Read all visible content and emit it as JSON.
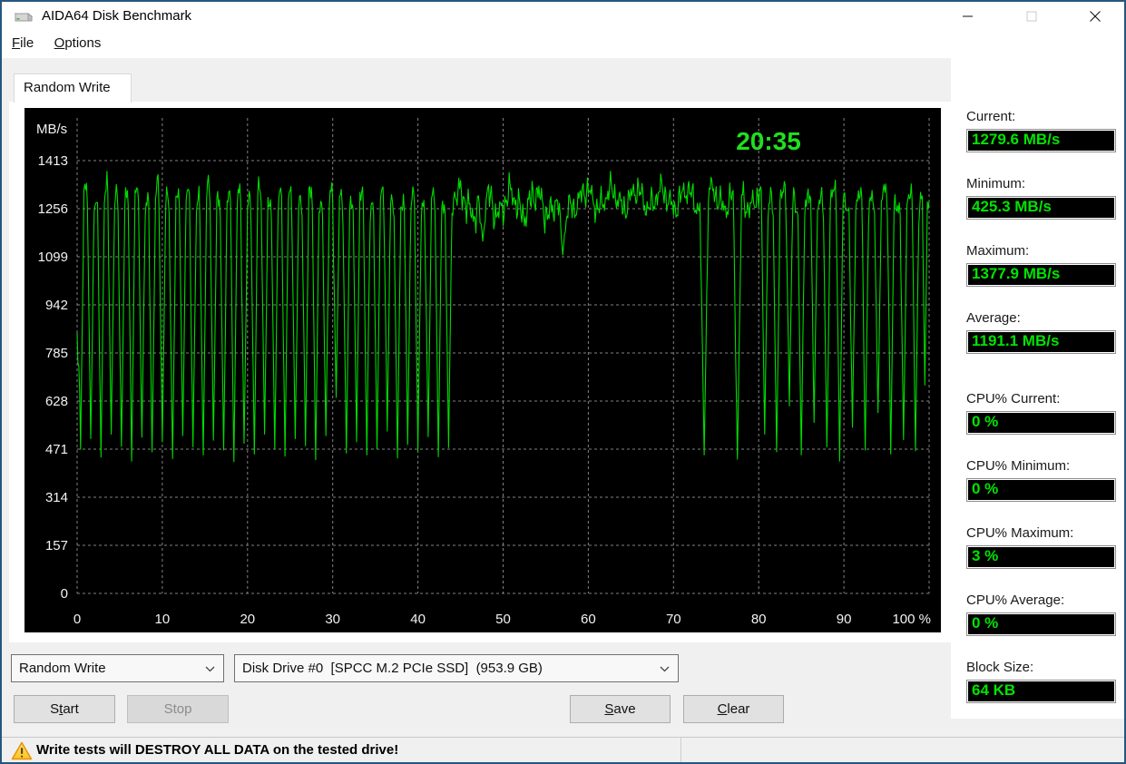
{
  "window": {
    "title": "AIDA64 Disk Benchmark",
    "app_icon": "disk-drive-icon",
    "controls": {
      "minimize": "minimize",
      "maximize": "maximize",
      "close": "close"
    }
  },
  "menu": {
    "file": {
      "text": "File",
      "accel": 0
    },
    "options": {
      "text": "Options",
      "accel": 0
    }
  },
  "tab": {
    "label": "Random Write"
  },
  "chart_data": {
    "type": "line",
    "series_name": "Random Write transfer rate",
    "unit": "MB/s",
    "ylabel": "MB/s",
    "elapsed_time": "20:35",
    "xlim": [
      0,
      100
    ],
    "ylim": [
      0,
      1570
    ],
    "y_ticks": [
      0,
      157,
      314,
      471,
      628,
      785,
      942,
      1099,
      1256,
      1413
    ],
    "x_ticks": [
      0,
      10,
      20,
      30,
      40,
      50,
      60,
      70,
      80,
      90,
      100
    ],
    "x_last_tick_label": "100 %",
    "grid": "dashed",
    "bg_color": "#000000",
    "line_color": "#00dc00",
    "timer_color": "#1fe01f",
    "axis_text_color": "#f2f2f2",
    "current": 1279.6,
    "minimum": 425.3,
    "maximum": 1377.9,
    "average": 1191.1,
    "baseline_segments": [
      {
        "x0": 0,
        "x1": 44.5,
        "mean": 1298,
        "amp": 58
      },
      {
        "x0": 44.5,
        "x1": 58.0,
        "mean": 1272,
        "amp": 80
      },
      {
        "x0": 58.0,
        "x1": 80.3,
        "mean": 1288,
        "amp": 66
      },
      {
        "x0": 80.3,
        "x1": 100.0,
        "mean": 1292,
        "amp": 60
      }
    ],
    "dips": [
      [
        0.05,
        780,
        0.3
      ],
      [
        0.4,
        470
      ],
      [
        1.6,
        505
      ],
      [
        2.8,
        445
      ],
      [
        4.0,
        520
      ],
      [
        5.2,
        480
      ],
      [
        6.4,
        432
      ],
      [
        7.6,
        510
      ],
      [
        8.8,
        462
      ],
      [
        10.0,
        495
      ],
      [
        11.2,
        440
      ],
      [
        12.4,
        515
      ],
      [
        13.6,
        478
      ],
      [
        14.8,
        452
      ],
      [
        16.0,
        500
      ],
      [
        17.2,
        468
      ],
      [
        18.4,
        430
      ],
      [
        19.6,
        490
      ],
      [
        20.8,
        455
      ],
      [
        22.0,
        520
      ],
      [
        23.2,
        472
      ],
      [
        24.4,
        448
      ],
      [
        25.6,
        505
      ],
      [
        26.8,
        482
      ],
      [
        28.0,
        436
      ],
      [
        29.2,
        515
      ],
      [
        30.4,
        640
      ],
      [
        31.6,
        458
      ],
      [
        32.8,
        495
      ],
      [
        34.0,
        452
      ],
      [
        35.2,
        472
      ],
      [
        36.4,
        530
      ],
      [
        37.6,
        442
      ],
      [
        38.8,
        486
      ],
      [
        40.0,
        466
      ],
      [
        41.2,
        512
      ],
      [
        42.4,
        446
      ],
      [
        43.6,
        476
      ],
      [
        47.6,
        1150,
        0.5
      ],
      [
        57.0,
        1105,
        0.6
      ],
      [
        73.6,
        452,
        0.5
      ],
      [
        77.5,
        438,
        0.5
      ],
      [
        80.7,
        520
      ],
      [
        82.1,
        462
      ],
      [
        83.6,
        612
      ],
      [
        85.0,
        452
      ],
      [
        86.5,
        558
      ],
      [
        88.0,
        478
      ],
      [
        89.5,
        432
      ],
      [
        91.0,
        542
      ],
      [
        92.5,
        468
      ],
      [
        94.0,
        590
      ],
      [
        95.5,
        455
      ],
      [
        97.0,
        502
      ],
      [
        98.4,
        466
      ],
      [
        99.5,
        680,
        0.3
      ]
    ]
  },
  "stats": {
    "groups": [
      {
        "label": "Current:",
        "value": "1279.6 MB/s"
      },
      {
        "label": "Minimum:",
        "value": "425.3 MB/s"
      },
      {
        "label": "Maximum:",
        "value": "1377.9 MB/s"
      },
      {
        "label": "Average:",
        "value": "1191.1 MB/s"
      },
      {
        "label": "CPU% Current:",
        "value": "0 %"
      },
      {
        "label": "CPU% Minimum:",
        "value": "0 %"
      },
      {
        "label": "CPU% Maximum:",
        "value": "3 %"
      },
      {
        "label": "CPU% Average:",
        "value": "0 %"
      },
      {
        "label": "Block Size:",
        "value": "64 KB"
      }
    ]
  },
  "controls": {
    "test_type_combo": {
      "value": "Random Write"
    },
    "drive_combo": {
      "value": "Disk Drive #0  [SPCC M.2 PCIe SSD]  (953.9 GB)"
    },
    "start": {
      "text": "Start",
      "accel": 1,
      "enabled": true
    },
    "stop": {
      "text": "Stop",
      "accel": -1,
      "enabled": false
    },
    "save": {
      "text": "Save",
      "accel": 0,
      "enabled": true
    },
    "clear": {
      "text": "Clear",
      "accel": 0,
      "enabled": true
    }
  },
  "status_bar": {
    "warning_text": "Write tests will DESTROY ALL DATA on the tested drive!"
  },
  "colors": {
    "window_border": "#26567f",
    "value_green": "#00e400",
    "chart_line_green": "#00dc00",
    "dialog_bg": "#f0f0f0",
    "warning_yellow": "#ffc82e",
    "warning_orange": "#e8940a"
  }
}
